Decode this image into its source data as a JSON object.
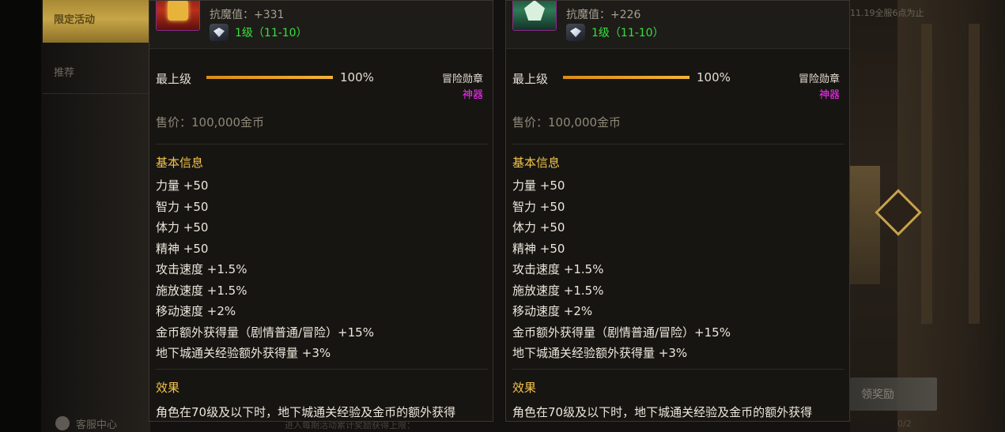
{
  "sidebar": {
    "tabs": [
      {
        "label": "限定活动",
        "active": true
      },
      {
        "label": "推荐",
        "active": false
      }
    ],
    "service_center": "客服中心"
  },
  "background": {
    "top_note": "11.19全服6点为止",
    "claim_button": "领奖励",
    "bottom_note": "进入每期活动累计奖励获得上限：",
    "bottom_count": "0/2"
  },
  "cards": [
    {
      "icon": "red-emblem-icon",
      "resist": "抗魔值：+331",
      "level": "1级（11-10）",
      "grade_label": "最上级",
      "grade_percent": "100%",
      "grade_fraction": 1.0,
      "category": "冒险勋章",
      "rarity": "神器",
      "price": "售价：100,000金币",
      "basic_title": "基本信息",
      "stats": [
        "力量 +50",
        "智力 +50",
        "体力 +50",
        "精神 +50",
        "攻击速度 +1.5%",
        "施放速度 +1.5%",
        "移动速度 +2%",
        "金币额外获得量（剧情普通/冒险）+15%",
        "地下城通关经验额外获得量 +3%"
      ],
      "effect_title": "效果",
      "effect_text": "角色在70级及以下时，地下城通关经验及金币的额外获得"
    },
    {
      "icon": "green-emblem-icon",
      "resist": "抗魔值：+226",
      "level": "1级（11-10）",
      "grade_label": "最上级",
      "grade_percent": "100%",
      "grade_fraction": 1.0,
      "category": "冒险勋章",
      "rarity": "神器",
      "price": "售价：100,000金币",
      "basic_title": "基本信息",
      "stats": [
        "力量 +50",
        "智力 +50",
        "体力 +50",
        "精神 +50",
        "攻击速度 +1.5%",
        "施放速度 +1.5%",
        "移动速度 +2%",
        "金币额外获得量（剧情普通/冒险）+15%",
        "地下城通关经验额外获得量 +3%"
      ],
      "effect_title": "效果",
      "effect_text": "角色在70级及以下时，地下城通关经验及金币的额外获得"
    }
  ],
  "colors": {
    "level_green": "#36e040",
    "section_gold": "#f2c24b",
    "rarity_magenta": "#ff2cff",
    "grade_bar": "#f2b436"
  }
}
